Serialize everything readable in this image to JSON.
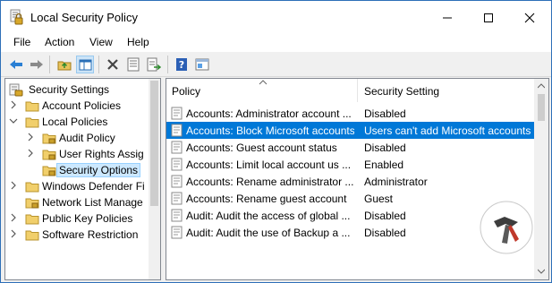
{
  "window": {
    "title": "Local Security Policy",
    "accent": "#0078d7"
  },
  "menu": [
    "File",
    "Action",
    "View",
    "Help"
  ],
  "toolbar": {
    "buttons": [
      "back-icon",
      "forward-icon",
      "up-folder-icon",
      "show-hide-tree-icon",
      "delete-icon",
      "properties-icon",
      "export-list-icon",
      "help-icon",
      "console-icon"
    ]
  },
  "tree": {
    "root": "Security Settings",
    "items": [
      {
        "label": "Account Policies",
        "level": 1,
        "expanded": false
      },
      {
        "label": "Local Policies",
        "level": 1,
        "expanded": true
      },
      {
        "label": "Audit Policy",
        "level": 2,
        "expanded": false
      },
      {
        "label": "User Rights Assignment",
        "level": 2,
        "expanded": false
      },
      {
        "label": "Security Options",
        "level": 2,
        "selected": true
      },
      {
        "label": "Windows Defender Firewall with Advanced Security",
        "level": 1,
        "expanded": false
      },
      {
        "label": "Network List Manager Policies",
        "level": 1
      },
      {
        "label": "Public Key Policies",
        "level": 1,
        "expanded": false
      },
      {
        "label": "Software Restriction Policies",
        "level": 1,
        "expanded": false
      }
    ]
  },
  "list": {
    "columns": [
      "Policy",
      "Security Setting"
    ],
    "rows": [
      {
        "policy": "Accounts: Administrator account status",
        "setting": "Disabled"
      },
      {
        "policy": "Accounts: Block Microsoft accounts",
        "setting": "Users can't add Microsoft accounts",
        "selected": true
      },
      {
        "policy": "Accounts: Guest account status",
        "setting": "Disabled"
      },
      {
        "policy": "Accounts: Limit local account use of blank passwords",
        "setting": "Enabled"
      },
      {
        "policy": "Accounts: Rename administrator account",
        "setting": "Administrator"
      },
      {
        "policy": "Accounts: Rename guest account",
        "setting": "Guest"
      },
      {
        "policy": "Audit: Audit the access of global system objects",
        "setting": "Disabled"
      },
      {
        "policy": "Audit: Audit the use of Backup and Restore privilege",
        "setting": "Disabled"
      }
    ]
  }
}
